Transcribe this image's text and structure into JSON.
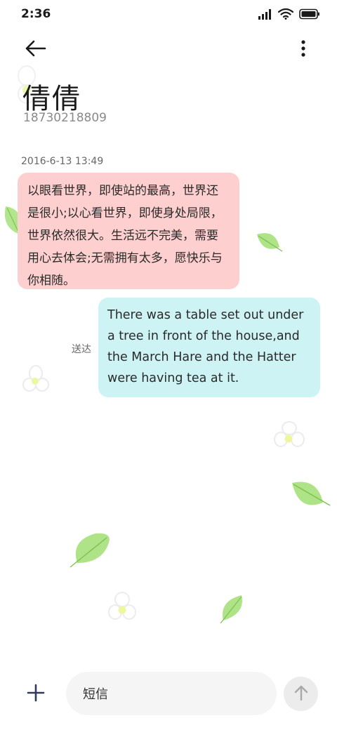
{
  "status_bar": {
    "time": "2:36",
    "icons": [
      "signal-icon",
      "wifi-icon",
      "battery-icon"
    ]
  },
  "header": {
    "back_icon": "arrow-left-icon",
    "more_icon": "more-vertical-icon",
    "contact_name": "倩倩",
    "contact_number": "18730218809"
  },
  "conversation": {
    "timestamp": "2016-6-13 13:49",
    "incoming_message": "以眼看世界，即使站的最高，世界还是很小;以心看世界，即使身处局限，世界依然很大。生活远不完美，需要用心去体会;无需拥有太多，愿快乐与你相随。",
    "outgoing_message": "There was a table set out under a tree in front of the house,and the March Hare and the Hatter were having tea at it.",
    "delivery_status": "送达"
  },
  "composer": {
    "plus_icon": "plus-icon",
    "input_placeholder": "短信",
    "send_icon": "arrow-up-icon"
  },
  "colors": {
    "incoming_bubble": "#fecfcf",
    "outgoing_bubble": "#cdf3f4",
    "leaf": "#8fd65a"
  }
}
